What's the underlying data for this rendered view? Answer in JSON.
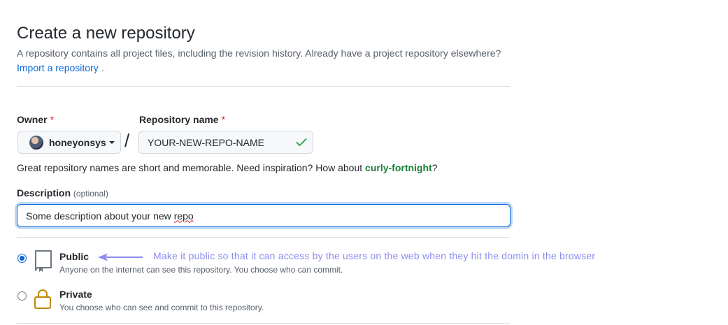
{
  "header": {
    "title": "Create a new repository",
    "subtitle": "A repository contains all project files, including the revision history. Already have a project repository elsewhere?",
    "import_link": "Import a repository",
    "import_suffix": "."
  },
  "form": {
    "owner": {
      "label": "Owner",
      "required_mark": "*",
      "value": "honeyonsys"
    },
    "separator": "/",
    "repo_name": {
      "label": "Repository name",
      "required_mark": "*",
      "value": "YOUR-NEW-REPO-NAME"
    },
    "hint": {
      "text": "Great repository names are short and memorable. Need inspiration? How about ",
      "suggestion": "curly-fortnight",
      "suffix": "?"
    },
    "description": {
      "label": "Description",
      "optional": "(optional)",
      "value_prefix": "Some description about your new ",
      "value_misspelled": "repo"
    }
  },
  "visibility": {
    "options": [
      {
        "title": "Public",
        "description": "Anyone on the internet can see this repository. You choose who can commit.",
        "selected": true,
        "icon": "repo-icon"
      },
      {
        "title": "Private",
        "description": "You choose who can see and commit to this repository.",
        "selected": false,
        "icon": "lock-icon"
      }
    ]
  },
  "annotation": {
    "text": "Make it public so that it can access by the users on the web when they hit the domin in the browser",
    "color": "#8d8cf0"
  },
  "colors": {
    "link": "#0969da",
    "required": "#cf222e",
    "success": "#1a7f37",
    "check": "#2da44e"
  }
}
